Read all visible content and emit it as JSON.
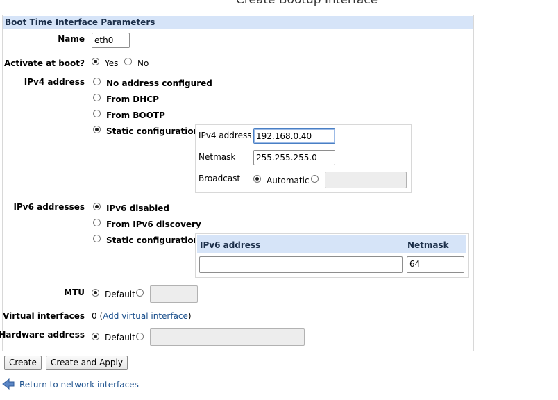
{
  "page_title": "Create Bootup Interface",
  "panel": {
    "header": "Boot Time Interface Parameters"
  },
  "name": {
    "label": "Name",
    "value": "eth0"
  },
  "activate": {
    "label": "Activate at boot?",
    "yes": "Yes",
    "no": "No",
    "selected": "Yes"
  },
  "ipv4": {
    "label": "IPv4 address",
    "options": [
      "No address configured",
      "From DHCP",
      "From BOOTP",
      "Static configuration"
    ],
    "selected": "Static configuration",
    "static": {
      "address_label": "IPv4 address",
      "address_value": "192.168.0.40",
      "netmask_label": "Netmask",
      "netmask_value": "255.255.255.0",
      "broadcast_label": "Broadcast",
      "broadcast_auto": "Automatic",
      "broadcast_value": ""
    }
  },
  "ipv6": {
    "label": "IPv6 addresses",
    "options": [
      "IPv6 disabled",
      "From IPv6 discovery",
      "Static configuration"
    ],
    "selected": "IPv6 disabled",
    "table": {
      "col_address": "IPv6 address",
      "col_netmask": "Netmask",
      "address_value": "",
      "netmask_value": "64"
    }
  },
  "mtu": {
    "label": "MTU",
    "default": "Default",
    "value": ""
  },
  "virtual": {
    "label": "Virtual interfaces",
    "count": "0",
    "open_paren": "(",
    "link": "Add virtual interface",
    "close_paren": ")"
  },
  "hardware": {
    "label": "Hardware address",
    "default": "Default",
    "value": ""
  },
  "buttons": {
    "create": "Create",
    "create_apply": "Create and Apply"
  },
  "return_link": "Return to network interfaces"
}
